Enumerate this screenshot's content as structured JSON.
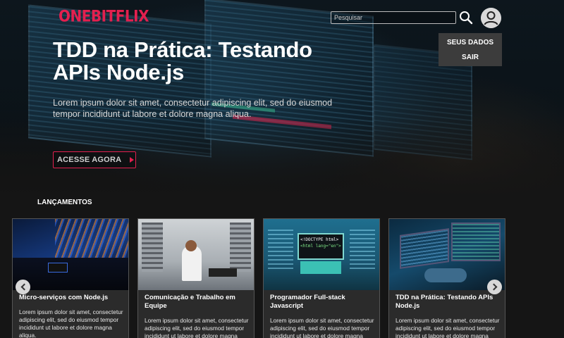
{
  "header": {
    "logo": "ONEBITFLIX",
    "search_placeholder": "Pesquisar",
    "dropdown": {
      "items": [
        "SEUS DADOS",
        "SAIR"
      ]
    }
  },
  "hero": {
    "title": "TDD na Prática: Testando APIs Node.js",
    "description": "Lorem ipsum dolor sit amet, consectetur adipiscing elit, sed do eiusmod tempor incididunt ut labore et dolore magna aliqua.",
    "cta_label": "ACESSE AGORA"
  },
  "section": {
    "title": "LANÇAMENTOS"
  },
  "cards": [
    {
      "title": "Micro-serviços com Node.js",
      "description": "Lorem ipsum dolor sit amet, consectetur adipiscing elit, sed do eiusmod tempor incididunt ut labore et dolore magna aliqua."
    },
    {
      "title": "Comunicação e Trabalho em Equipe",
      "description": "Lorem ipsum dolor sit amet, consectetur adipiscing elit, sed do eiusmod tempor incididunt ut labore et dolore magna aliqua."
    },
    {
      "title": "Programador Full-stack Javascript",
      "description": "Lorem ipsum dolor sit amet, consectetur adipiscing elit, sed do eiusmod tempor incididunt ut labore et dolore magna aliqua.",
      "thumb_text": [
        "<!DOCTYPE html>",
        "<html lang=\"en\">"
      ]
    },
    {
      "title": "TDD na Prática: Testando APIs Node.js",
      "description": "Lorem ipsum dolor sit amet, consectetur adipiscing elit, sed do eiusmod tempor incididunt ut labore et dolore magna aliqua."
    }
  ],
  "colors": {
    "accent": "#e3204f",
    "background": "#151515",
    "card_background": "#2b2b2b",
    "dropdown_background": "#3c3c3c"
  },
  "icons": {
    "search": "search-icon",
    "avatar": "user-icon",
    "cta": "play-icon",
    "prev": "chevron-left-icon",
    "next": "chevron-right-icon"
  }
}
